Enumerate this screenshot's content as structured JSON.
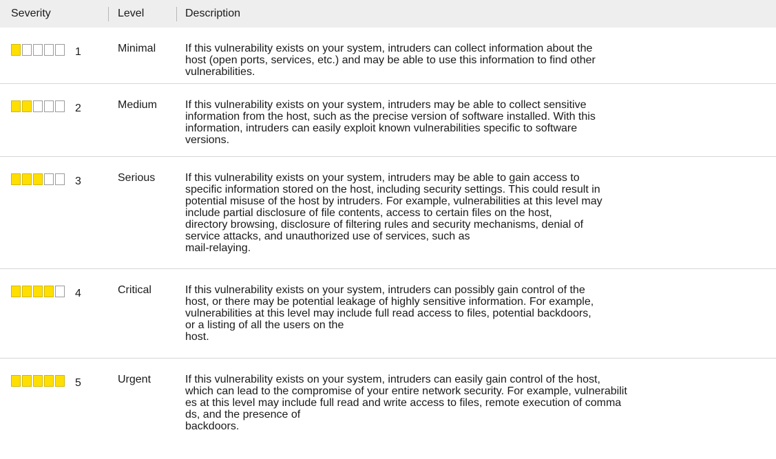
{
  "table": {
    "headers": {
      "severity": "Severity",
      "level": "Level",
      "description": "Description"
    },
    "rows": [
      {
        "severity": "1",
        "filled_segments": 1,
        "level": "Minimal",
        "description": "If this vulnerability exists on your system, intruders can collect information about the\nhost (open ports, services, etc.) and may be able to use this information to find other\nvulnerabilities."
      },
      {
        "severity": "2",
        "filled_segments": 2,
        "level": "Medium",
        "description": "If this vulnerability exists on your system, intruders may be able to collect sensitive\ninformation from the host, such as the precise version of software installed. With this\ninformation, intruders can easily exploit known vulnerabilities specific to software\nversions."
      },
      {
        "severity": "3",
        "filled_segments": 3,
        "level": "Serious",
        "description": "If this vulnerability exists on your system, intruders may be able to gain access to\nspecific information stored on the host, including security settings. This could result in\npotential misuse of the host by intruders. For example, vulnerabilities at this level may\ninclude partial disclosure of file contents, access to certain files on the host,\ndirectory browsing, disclosure of filtering rules and security mechanisms, denial of\nservice attacks, and unauthorized use of services, such as\nmail-relaying."
      },
      {
        "severity": "4",
        "filled_segments": 4,
        "level": "Critical",
        "description": "If this vulnerability exists on your system, intruders can possibly gain control of the\nhost, or there may be potential leakage of highly sensitive information. For example,\nvulnerabilities at this level may include full read access to files, potential backdoors,\nor a listing of all the users on the\nhost."
      },
      {
        "severity": "5",
        "filled_segments": 5,
        "level": "Urgent",
        "description": "If this vulnerability exists on your system, intruders can easily gain control of the host,\nwhich can lead to the compromise of your entire network security. For example, vulnerabilit\nes at this level may include full read and write access to files, remote execution of comma\nds, and the presence of\nbackdoors."
      }
    ]
  },
  "colors": {
    "segment_filled": "#ffdf00",
    "segment_empty": "#ffffff",
    "header_bg": "#eeeeee"
  }
}
